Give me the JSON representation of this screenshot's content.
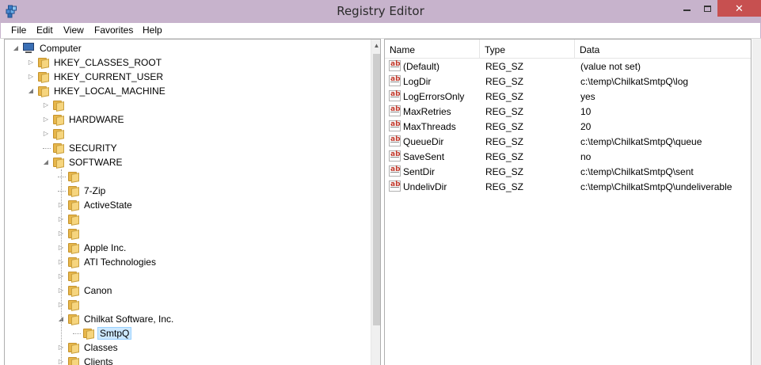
{
  "window": {
    "title": "Registry Editor",
    "close_glyph": "✕"
  },
  "menu": [
    "File",
    "Edit",
    "View",
    "Favorites",
    "Help"
  ],
  "tree": [
    {
      "label": "Computer",
      "indent": 0,
      "expander": "open",
      "icon": "computer-icon"
    },
    {
      "label": "HKEY_CLASSES_ROOT",
      "indent": 1,
      "expander": "closed",
      "icon": "folder-icon"
    },
    {
      "label": "HKEY_CURRENT_USER",
      "indent": 1,
      "expander": "closed",
      "icon": "folder-icon"
    },
    {
      "label": "HKEY_LOCAL_MACHINE",
      "indent": 1,
      "expander": "open",
      "icon": "folder-icon"
    },
    {
      "label": "",
      "indent": 2,
      "expander": "closed",
      "icon": "folder-icon"
    },
    {
      "label": "HARDWARE",
      "indent": 2,
      "expander": "closed",
      "icon": "folder-icon"
    },
    {
      "label": "",
      "indent": 2,
      "expander": "closed",
      "icon": "folder-icon"
    },
    {
      "label": "SECURITY",
      "indent": 2,
      "expander": "none",
      "icon": "folder-icon"
    },
    {
      "label": "SOFTWARE",
      "indent": 2,
      "expander": "open",
      "icon": "folder-icon"
    },
    {
      "label": "",
      "indent": 3,
      "expander": "none",
      "icon": "folder-icon"
    },
    {
      "label": "7-Zip",
      "indent": 3,
      "expander": "none",
      "icon": "folder-icon"
    },
    {
      "label": "ActiveState",
      "indent": 3,
      "expander": "closed",
      "icon": "folder-icon"
    },
    {
      "label": "",
      "indent": 3,
      "expander": "closed",
      "icon": "folder-icon"
    },
    {
      "label": "",
      "indent": 3,
      "expander": "closed",
      "icon": "folder-icon"
    },
    {
      "label": "Apple Inc.",
      "indent": 3,
      "expander": "closed",
      "icon": "folder-icon"
    },
    {
      "label": "ATI Technologies",
      "indent": 3,
      "expander": "closed",
      "icon": "folder-icon"
    },
    {
      "label": "",
      "indent": 3,
      "expander": "closed",
      "icon": "folder-icon"
    },
    {
      "label": "Canon",
      "indent": 3,
      "expander": "closed",
      "icon": "folder-icon"
    },
    {
      "label": "",
      "indent": 3,
      "expander": "closed",
      "icon": "folder-icon"
    },
    {
      "label": "Chilkat Software, Inc.",
      "indent": 3,
      "expander": "open",
      "icon": "folder-icon"
    },
    {
      "label": "SmtpQ",
      "indent": 4,
      "expander": "none",
      "icon": "folder-icon",
      "selected": true
    },
    {
      "label": "Classes",
      "indent": 3,
      "expander": "closed",
      "icon": "folder-icon"
    },
    {
      "label": "Clients",
      "indent": 3,
      "expander": "closed",
      "icon": "folder-icon"
    }
  ],
  "list": {
    "columns": [
      "Name",
      "Type",
      "Data"
    ],
    "rows": [
      {
        "name": "(Default)",
        "type": "REG_SZ",
        "data": "(value not set)"
      },
      {
        "name": "LogDir",
        "type": "REG_SZ",
        "data": "c:\\temp\\ChilkatSmtpQ\\log"
      },
      {
        "name": "LogErrorsOnly",
        "type": "REG_SZ",
        "data": "yes"
      },
      {
        "name": "MaxRetries",
        "type": "REG_SZ",
        "data": "10"
      },
      {
        "name": "MaxThreads",
        "type": "REG_SZ",
        "data": "20"
      },
      {
        "name": "QueueDir",
        "type": "REG_SZ",
        "data": "c:\\temp\\ChilkatSmtpQ\\queue"
      },
      {
        "name": "SaveSent",
        "type": "REG_SZ",
        "data": "no"
      },
      {
        "name": "SentDir",
        "type": "REG_SZ",
        "data": "c:\\temp\\ChilkatSmtpQ\\sent"
      },
      {
        "name": "UndelivDir",
        "type": "REG_SZ",
        "data": "c:\\temp\\ChilkatSmtpQ\\undeliverable"
      }
    ],
    "value_icon_text": "ab"
  },
  "colors": {
    "titlebar": "#c7b3cc",
    "close": "#c75050",
    "selection": "#cce8ff"
  }
}
